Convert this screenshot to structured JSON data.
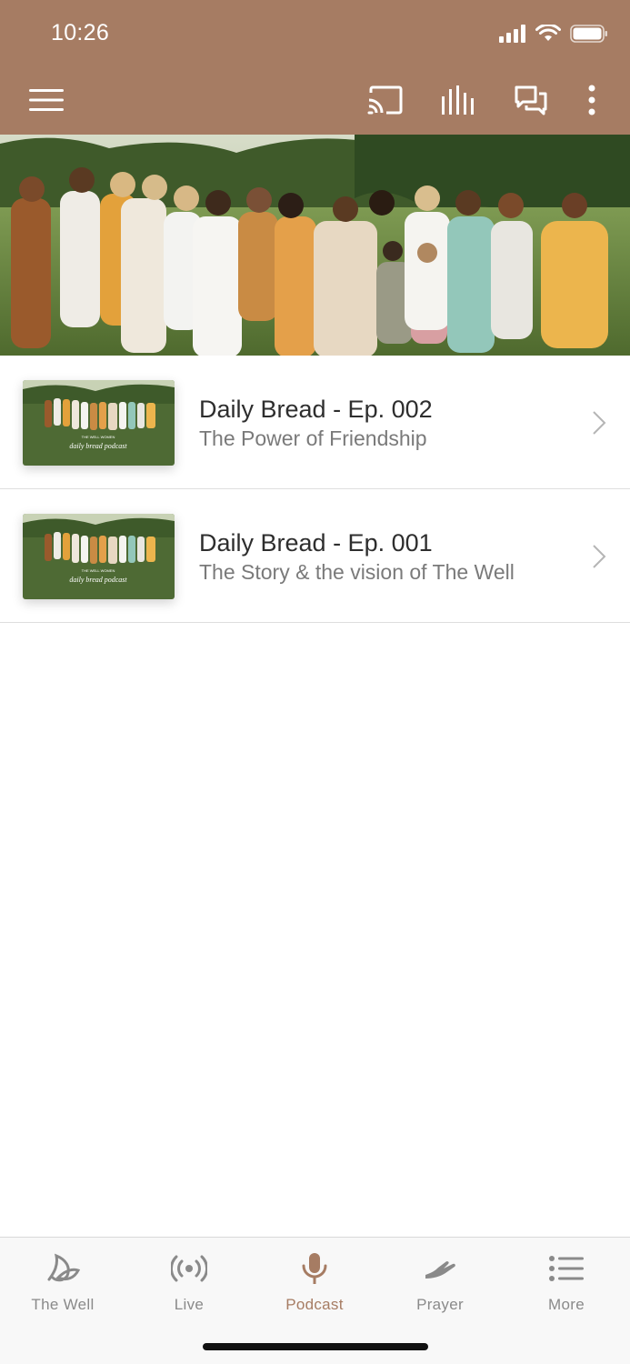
{
  "status_bar": {
    "time": "10:26"
  },
  "colors": {
    "brand": "#a67c63",
    "tab_inactive": "#8a8a8a",
    "text_primary": "#2e2e2e",
    "text_secondary": "#7a7a7a"
  },
  "toolbar": {
    "icons": [
      "menu-icon",
      "cast-icon",
      "audio-bars-icon",
      "chat-icon",
      "more-vertical-icon"
    ]
  },
  "hero": {
    "image": "group-photo"
  },
  "episodes": [
    {
      "title": "Daily Bread - Ep. 002",
      "subtitle": "The Power of Friendship",
      "thumb_caption": "daily bread podcast",
      "thumb_kicker": "THE WELL WOMEN"
    },
    {
      "title": "Daily Bread - Ep. 001",
      "subtitle": "The Story & the vision of The Well",
      "thumb_caption": "daily bread podcast",
      "thumb_kicker": "THE WELL WOMEN"
    }
  ],
  "tabs": [
    {
      "label": "The Well",
      "icon": "leaf-icon",
      "active": false
    },
    {
      "label": "Live",
      "icon": "broadcast-icon",
      "active": false
    },
    {
      "label": "Podcast",
      "icon": "microphone-icon",
      "active": true
    },
    {
      "label": "Prayer",
      "icon": "praying-hands-icon",
      "active": false
    },
    {
      "label": "More",
      "icon": "list-icon",
      "active": false
    }
  ]
}
